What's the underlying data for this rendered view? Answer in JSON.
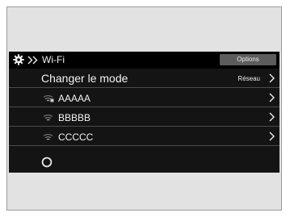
{
  "header": {
    "icon_settings": "gear-icon",
    "icon_nav": "double-chevron-right-icon",
    "title": "Wi-Fi",
    "options_label": "Options"
  },
  "mode_row": {
    "label": "Changer le mode",
    "value": "Réseau",
    "icon": "chevron-right-icon"
  },
  "networks": [
    {
      "name": "AAAAA",
      "icon": "wifi-locked-icon"
    },
    {
      "name": "BBBBB",
      "icon": "wifi-icon"
    },
    {
      "name": "CCCCC",
      "icon": "wifi-icon"
    }
  ],
  "status": {
    "icon": "loading-spinner-icon"
  },
  "colors": {
    "screen_bg": "#141414",
    "header_bg": "#000000",
    "button_bg": "#5c5c5c",
    "text": "#f2f2f2",
    "divider": "#4a4a4a"
  }
}
